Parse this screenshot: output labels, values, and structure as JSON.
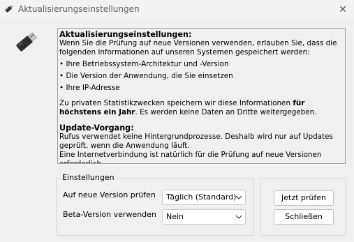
{
  "window": {
    "title": "Aktualisierungseinstellungen",
    "title_icon": "usb-drive-icon",
    "close_glyph": "✕"
  },
  "app_icon": "usb-drive-icon",
  "info": {
    "heading1": "Aktualisierungseinstellungen:",
    "intro": "Wenn Sie die Prüfung auf neue Versionen verwenden, erlauben Sie, dass die folgenden Informationen auf unseren Systemen gespeichert werden:",
    "bullets": [
      "Ihre Betriebssystem-Architektur und -Version",
      "Die Version der Anwendung, die Sie einsetzen",
      "Ihre IP-Adresse"
    ],
    "privacy_prefix": "Zu privaten Statistikzwecken speichern wir diese Informationen ",
    "privacy_bold": "für höchstens ein Jahr",
    "privacy_suffix": ". Es werden keine Daten an Dritte weitergegeben.",
    "heading2": "Update-Vorgang:",
    "process_text": "Rufus verwendet keine Hintergrundprozesse. Deshalb wird nur auf Updates geprüft, wenn die Anwendung läuft.",
    "internet_text": "Eine Internetverbindung ist natürlich für die Prüfung auf neue Versionen erforderlich."
  },
  "settings": {
    "group_label": "Einstellungen",
    "check_label": "Auf neue Version prüfen",
    "check_value": "Täglich (Standard)",
    "beta_label": "Beta-Version verwenden",
    "beta_value": "Nein"
  },
  "buttons": {
    "check_now": "Jetzt prüfen",
    "close": "Schließen"
  },
  "colors": {
    "window_bg": "#f0f0f0",
    "border": "#a0a0a0"
  }
}
